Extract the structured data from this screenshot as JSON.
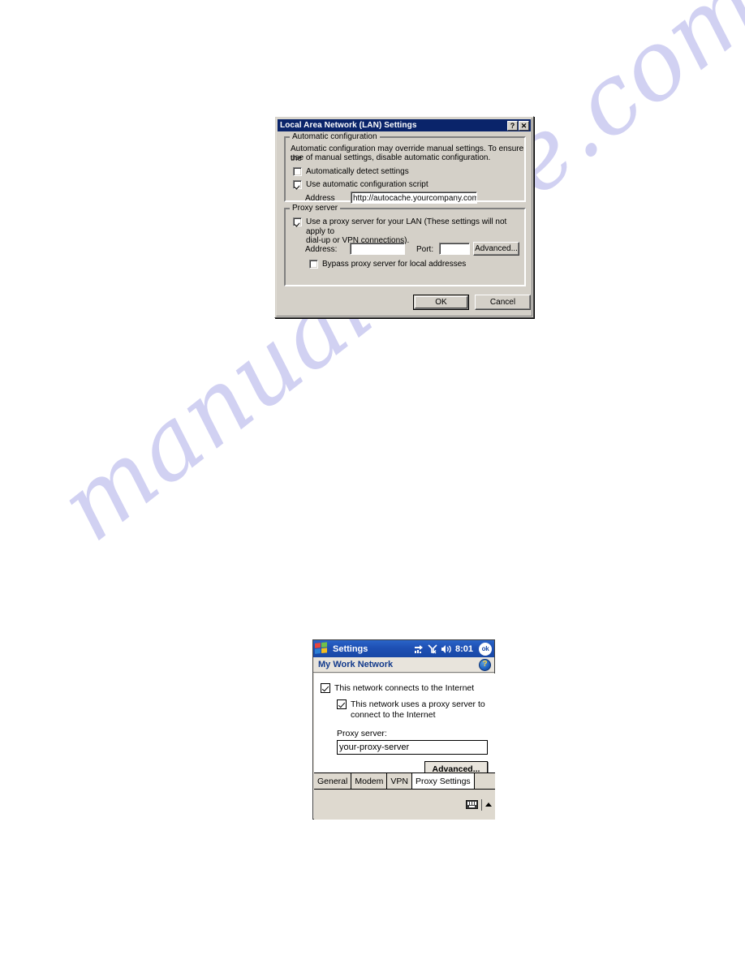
{
  "watermark": {
    "text": "manualshive.com"
  },
  "lan_dialog": {
    "title": "Local Area Network (LAN) Settings",
    "titlebar_buttons": {
      "help": "?",
      "close": "✕"
    },
    "automatic_configuration": {
      "legend": "Automatic configuration",
      "description_line1": "Automatic configuration may override manual settings.  To ensure the",
      "description_line2": "use of manual settings, disable automatic configuration.",
      "auto_detect": {
        "label": "Automatically detect settings",
        "checked": false
      },
      "use_script": {
        "label": "Use automatic configuration script",
        "checked": true
      },
      "address_label": "Address",
      "address_value": "http://autocache.yourcompany.com"
    },
    "proxy_server": {
      "legend": "Proxy server",
      "use_proxy": {
        "label_line1": "Use a proxy server for your LAN (These settings will not apply to",
        "label_line2": "dial-up or VPN connections).",
        "checked": true
      },
      "address_label": "Address:",
      "address_value": "",
      "port_label": "Port:",
      "port_value": "",
      "advanced_button": "Advanced...",
      "bypass": {
        "label": "Bypass proxy server for local addresses",
        "checked": false
      }
    },
    "ok_button": "OK",
    "cancel_button": "Cancel"
  },
  "pocketpc_dialog": {
    "titlebar": {
      "app_title": "Settings",
      "start_icon": "windows-flag-icon",
      "status_icons": [
        "connectivity-icon",
        "signal-off-icon",
        "volume-icon"
      ],
      "time": "8:01",
      "ok_label": "ok"
    },
    "subheader": {
      "title": "My Work Network",
      "help_icon_label": "?"
    },
    "connects_checkbox": {
      "label": "This network connects to the Internet",
      "checked": true
    },
    "proxy_checkbox": {
      "label_line1": "This network uses a proxy server to",
      "label_line2": "connect to the Internet",
      "checked": true
    },
    "proxy_server_label": "Proxy server:",
    "proxy_server_value": "your-proxy-server",
    "advanced_button": "Advanced...",
    "tabs": [
      {
        "label": "General",
        "active": false
      },
      {
        "label": "Modem",
        "active": false
      },
      {
        "label": "VPN",
        "active": false
      },
      {
        "label": "Proxy Settings",
        "active": true
      }
    ],
    "bottom_bar": {
      "keyboard_icon": "keyboard-icon",
      "up_arrow_icon": "chevron-up-icon"
    }
  }
}
